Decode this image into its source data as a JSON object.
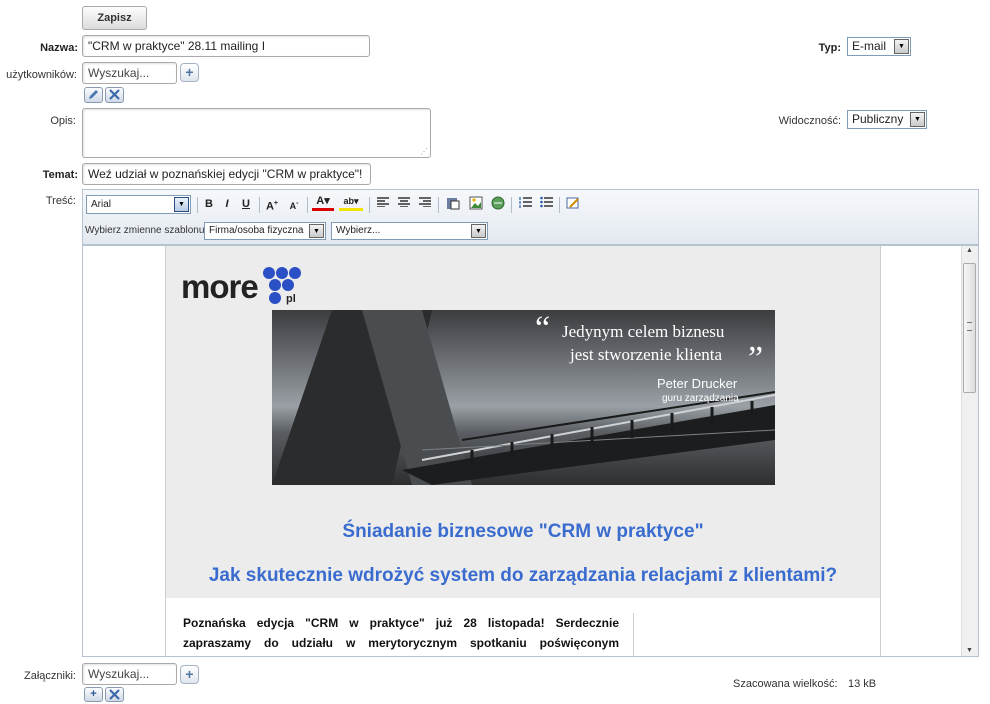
{
  "toolbar_top": {
    "save_label": "Zapisz"
  },
  "form": {
    "name_label": "Nazwa:",
    "name_value": "\"CRM w praktyce\" 28.11 mailing I",
    "type_label": "Typ:",
    "type_value": "E-mail",
    "users_label": "użytkowników:",
    "users_placeholder": "Wyszukaj...",
    "desc_label": "Opis:",
    "visibility_label": "Widoczność:",
    "visibility_value": "Publiczny",
    "subject_label": "Temat:",
    "subject_value": "Weź udział w poznańskiej edycji \"CRM w praktyce\"!",
    "content_label": "Treść:",
    "attachments_label": "Załączniki:",
    "attachments_placeholder": "Wyszukaj...",
    "size_label": "Szacowana wielkość:",
    "size_value": "13 kB"
  },
  "editor_toolbar": {
    "font_value": "Arial",
    "template_vars_label": "Wybierz zmienne szablonu",
    "entity_value": "Firma/osoba fizyczna",
    "field_value": "Wybierz..."
  },
  "email": {
    "logo_text": "more",
    "logo_suffix": "pl",
    "quote_open": "“",
    "quote_line1": "Jedynym celem biznesu",
    "quote_line2": "jest stworzenie klienta",
    "quote_close": "”",
    "quote_author": "Peter Drucker",
    "quote_author_role": "guru zarządzania",
    "heading1": "Śniadanie biznesowe \"CRM w praktyce\"",
    "heading2": "Jak skutecznie wdrożyć system do zarządzania relacjami z klientami?",
    "body_line1": "Poznańska edycja \"CRM w praktyce\" już 28 listopada! Serdecznie",
    "body_line2": "zapraszamy do udziału w merytorycznym spotkaniu poświęconym"
  },
  "colors": {
    "heading_blue": "#3a6ccf",
    "logo_dots": "#2b4fc4"
  }
}
